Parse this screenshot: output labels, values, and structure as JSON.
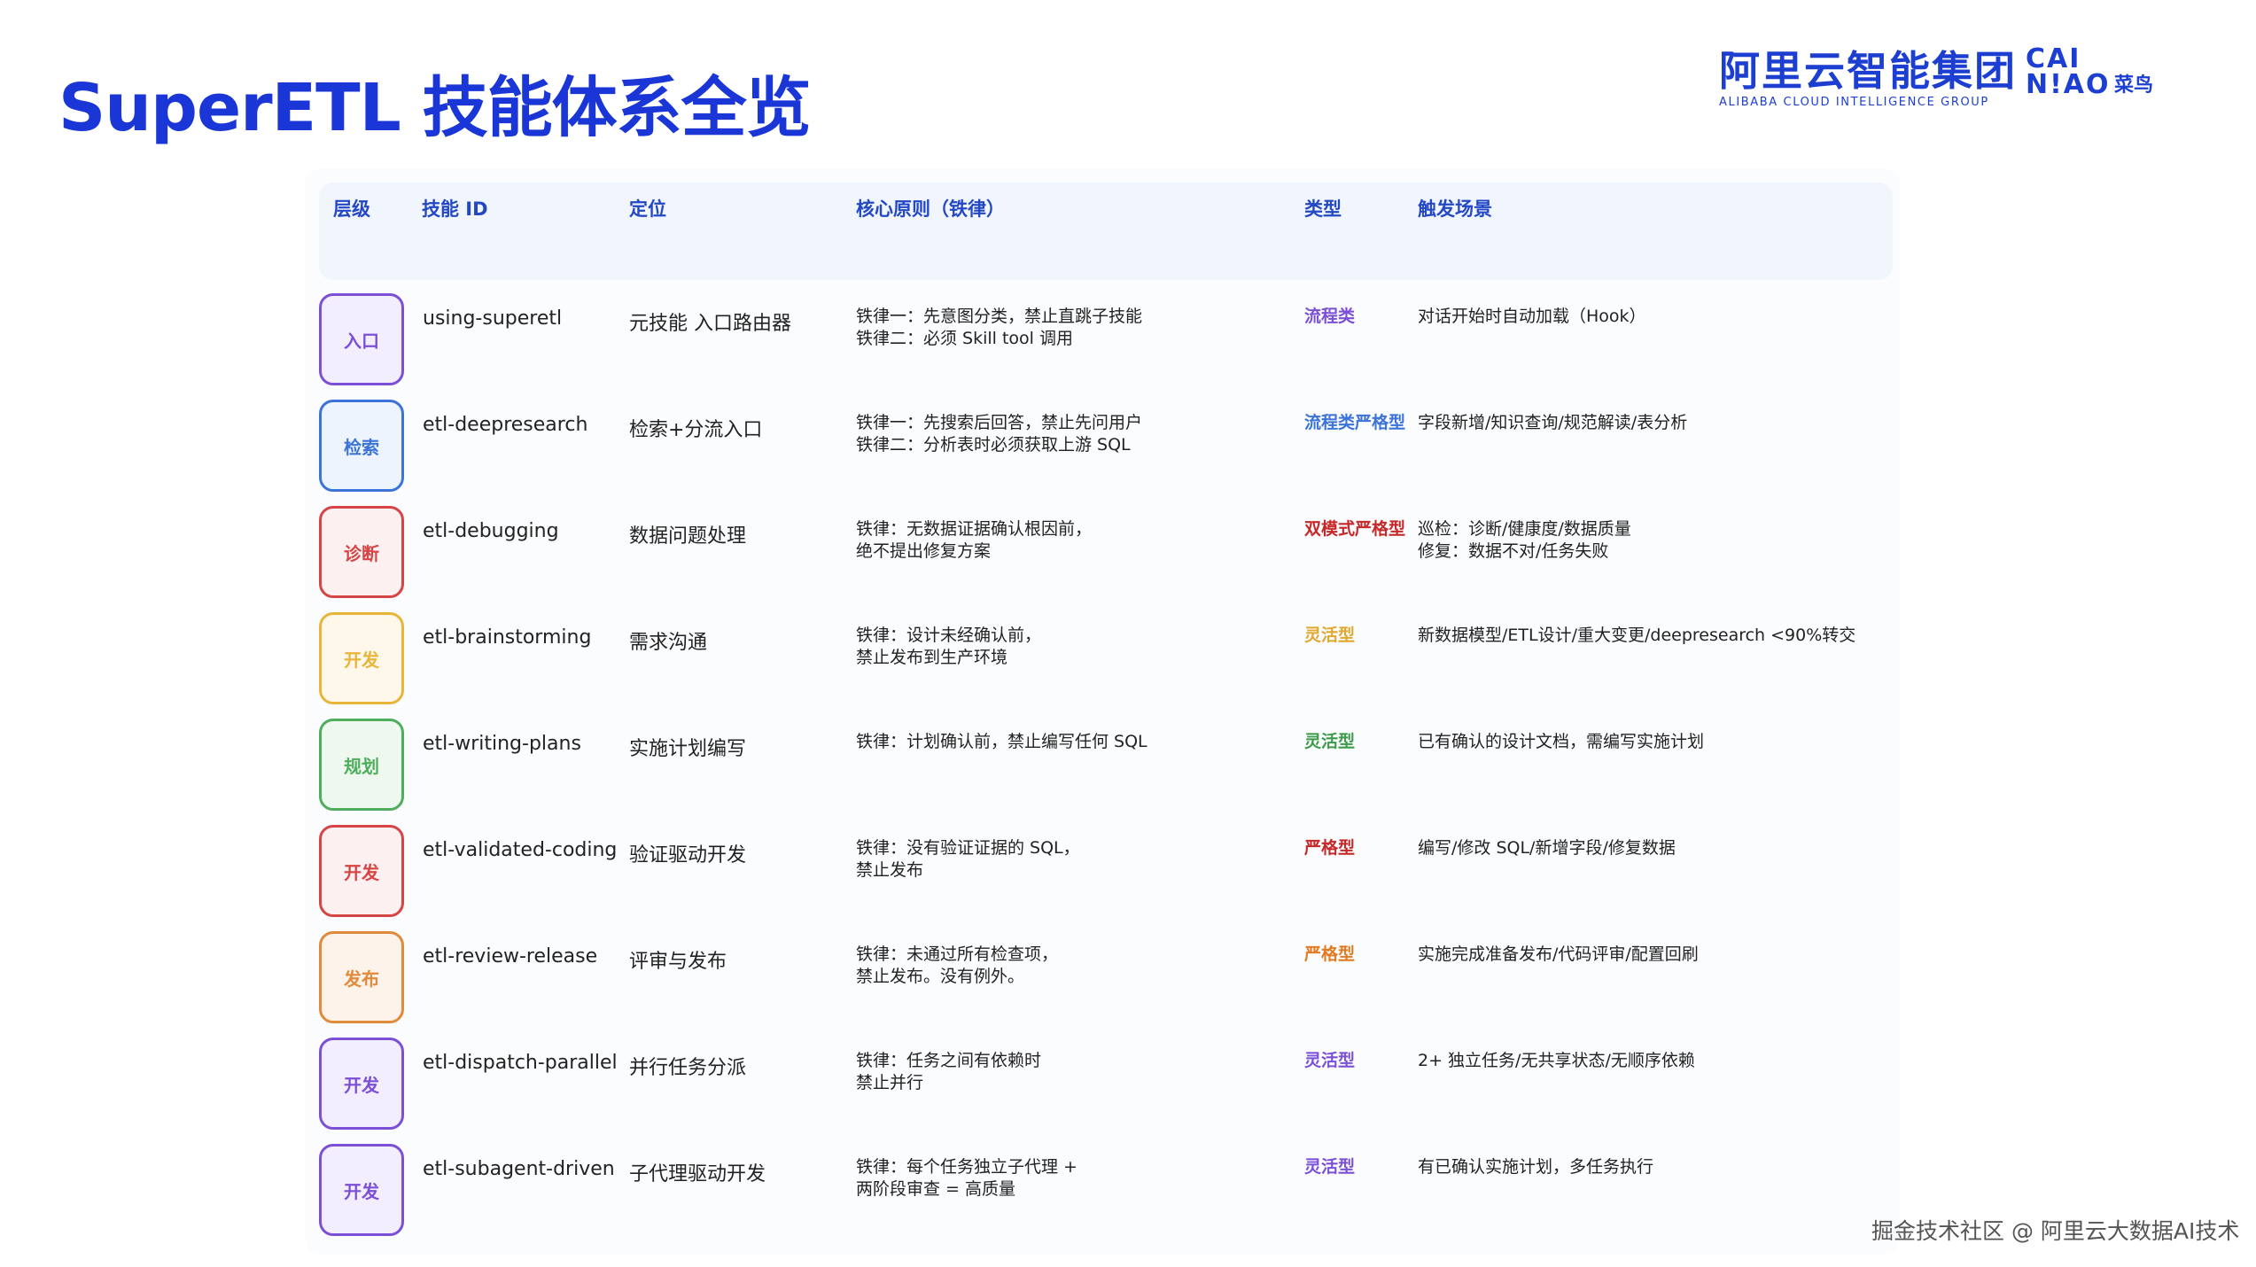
{
  "slide": {
    "title": "SuperETL 技能体系全览",
    "footer": "掘金技术社区 @ 阿里云大数据AI技术"
  },
  "logos": {
    "alibaba_cn": "阿里云智能集团",
    "alibaba_en": "ALIBABA CLOUD INTELLIGENCE GROUP",
    "cainiao_top": "CAI",
    "cainiao_bottom": "N!AO",
    "cainiao_cn": "菜鸟"
  },
  "table": {
    "headers": {
      "level": "层级",
      "skill_id": "技能 ID",
      "position": "定位",
      "principle": "核心原则（铁律）",
      "type": "类型",
      "trigger": "触发场景"
    },
    "rows": [
      {
        "level": "入口",
        "level_color": "#7b4fd6",
        "level_bg": "#f3eefd",
        "skill_id": "using-superetl",
        "position": "元技能 入口路由器",
        "principle": [
          "铁律一：先意图分类，禁止直跳子技能",
          "铁律二：必须 Skill tool 调用"
        ],
        "type": [
          "流程类"
        ],
        "type_color": "#7b4fd6",
        "trigger": [
          "对话开始时自动加载（Hook）"
        ]
      },
      {
        "level": "检索",
        "level_color": "#3b73d9",
        "level_bg": "#eef4fd",
        "skill_id": "etl-deepresearch",
        "position": "检索+分流入口",
        "principle": [
          "铁律一：先搜索后回答，禁止先问用户",
          "铁律二：分析表时必须获取上游 SQL"
        ],
        "type": [
          "流程类",
          "严格型"
        ],
        "type_color": "#3b73d9",
        "trigger": [
          "字段新增/知识查询/规范解读/表分析"
        ]
      },
      {
        "level": "诊断",
        "level_color": "#d64545",
        "level_bg": "#fdf0f0",
        "skill_id": "etl-debugging",
        "position": "数据问题处理",
        "principle": [
          "铁律：无数据证据确认根因前，",
          "绝不提出修复方案"
        ],
        "type": [
          "双模式",
          "严格型"
        ],
        "type_color": "#c62828",
        "trigger": [
          "巡检：诊断/健康度/数据质量",
          "修复：数据不对/任务失败"
        ]
      },
      {
        "level": "开发",
        "level_color": "#e8b53a",
        "level_bg": "#fdf8ea",
        "skill_id": "etl-brainstorming",
        "position": "需求沟通",
        "principle": [
          "铁律：设计未经确认前，",
          "禁止发布到生产环境"
        ],
        "type": [
          "灵活型"
        ],
        "type_color": "#e0a82e",
        "trigger": [
          "新数据模型/ETL设计/重大变更/deepresearch <90%转交"
        ]
      },
      {
        "level": "规划",
        "level_color": "#4fae5e",
        "level_bg": "#eef8ef",
        "skill_id": "etl-writing-plans",
        "position": "实施计划编写",
        "principle": [
          "铁律：计划确认前，禁止编写任何 SQL"
        ],
        "type": [
          "灵活型"
        ],
        "type_color": "#3d9a4b",
        "trigger": [
          "已有确认的设计文档，需编写实施计划"
        ]
      },
      {
        "level": "开发",
        "level_color": "#d64545",
        "level_bg": "#fdf0f0",
        "skill_id": "etl-validated-coding",
        "position": "验证驱动开发",
        "principle": [
          "铁律：没有验证证据的 SQL，",
          "禁止发布"
        ],
        "type": [
          "严格型"
        ],
        "type_color": "#c62828",
        "trigger": [
          "编写/修改 SQL/新增字段/修复数据"
        ]
      },
      {
        "level": "发布",
        "level_color": "#e08a3c",
        "level_bg": "#fdf3ea",
        "skill_id": "etl-review-release",
        "position": "评审与发布",
        "principle": [
          "铁律：未通过所有检查项，",
          "禁止发布。没有例外。"
        ],
        "type": [
          "严格型"
        ],
        "type_color": "#e07b22",
        "trigger": [
          "实施完成准备发布/代码评审/配置回刷"
        ]
      },
      {
        "level": "开发",
        "level_color": "#7b4fd6",
        "level_bg": "#f3eefd",
        "skill_id": "etl-dispatch-parallel",
        "position": "并行任务分派",
        "principle": [
          "铁律：任务之间有依赖时",
          "禁止并行"
        ],
        "type": [
          "灵活型"
        ],
        "type_color": "#7b4fd6",
        "trigger": [
          "2+ 独立任务/无共享状态/无顺序依赖"
        ]
      },
      {
        "level": "开发",
        "level_color": "#7b4fd6",
        "level_bg": "#f3eefd",
        "skill_id": "etl-subagent-driven",
        "position": "子代理驱动开发",
        "principle": [
          "铁律：每个任务独立子代理 +",
          "两阶段审查 = 高质量"
        ],
        "type": [
          "灵活型"
        ],
        "type_color": "#7b4fd6",
        "trigger": [
          "有已确认实施计划，多任务执行"
        ]
      }
    ]
  }
}
